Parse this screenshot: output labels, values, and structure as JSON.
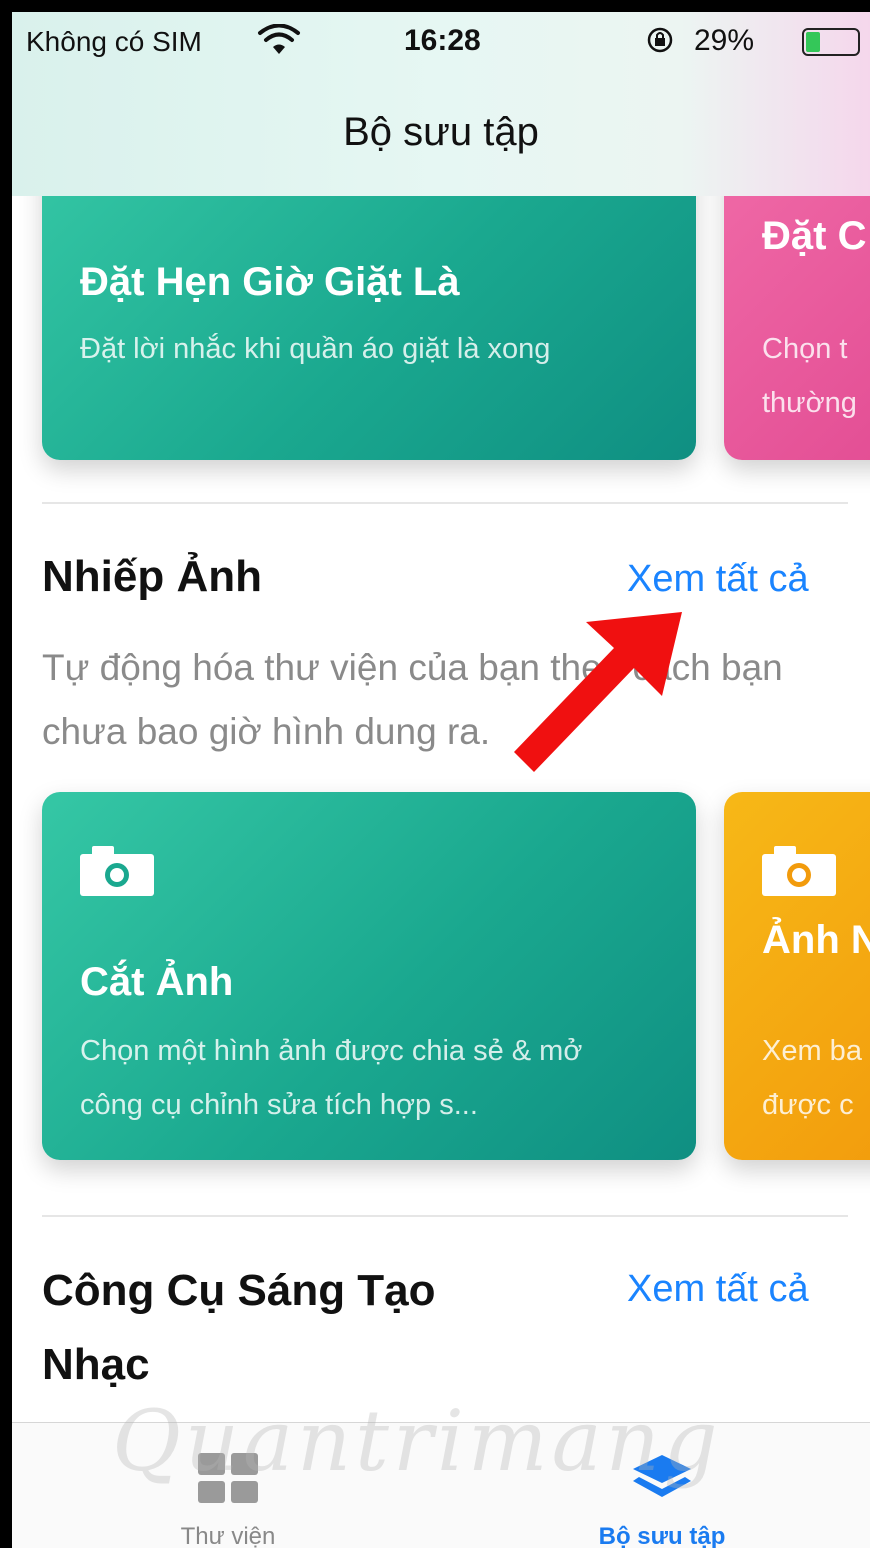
{
  "status_bar": {
    "carrier": "Không có SIM",
    "time": "16:28",
    "battery": "29%",
    "battery_level": 0.29,
    "icons": [
      "wifi-icon",
      "orientation-lock-icon",
      "battery-icon",
      "charging-icon"
    ]
  },
  "header": {
    "title": "Bộ sưu tập"
  },
  "top_cards": [
    {
      "title": "Đặt Hẹn Giờ Giặt Là",
      "desc": "Đặt lời nhắc khi quần áo giặt là xong",
      "color": "#1aa88f"
    },
    {
      "title": "Đặt C",
      "desc": "Chọn t thường",
      "color": "#e24c93"
    }
  ],
  "photo_section": {
    "title": "Nhiếp Ảnh",
    "see_all": "Xem tất cả",
    "desc": "Tự động hóa thư viện của bạn theo cách bạn chưa bao giờ hình dung ra."
  },
  "photo_cards": [
    {
      "title": "Cắt Ảnh",
      "desc": "Chọn một hình ảnh được chia sẻ & mở công cụ chỉnh sửa tích hợp s...",
      "icon": "camera-icon",
      "color": "#1aa88f"
    },
    {
      "title": "Ảnh N",
      "desc": "Xem ba được c",
      "icon": "camera-icon",
      "color": "#f29b0c"
    }
  ],
  "music_section": {
    "title": "Công Cụ Sáng Tạo Nhạc",
    "see_all": "Xem tất cả"
  },
  "tab_bar": {
    "tabs": [
      {
        "label": "Thư viện",
        "icon": "grid-icon",
        "active": false
      },
      {
        "label": "Bộ sưu tập",
        "icon": "layers-icon",
        "active": true
      }
    ]
  },
  "watermark": "Quantrimang",
  "colors": {
    "accent": "#1a84ff",
    "teal": "#1aa88f",
    "pink": "#e24c93",
    "yellow": "#f29b0c",
    "annotation": "#f01010"
  }
}
